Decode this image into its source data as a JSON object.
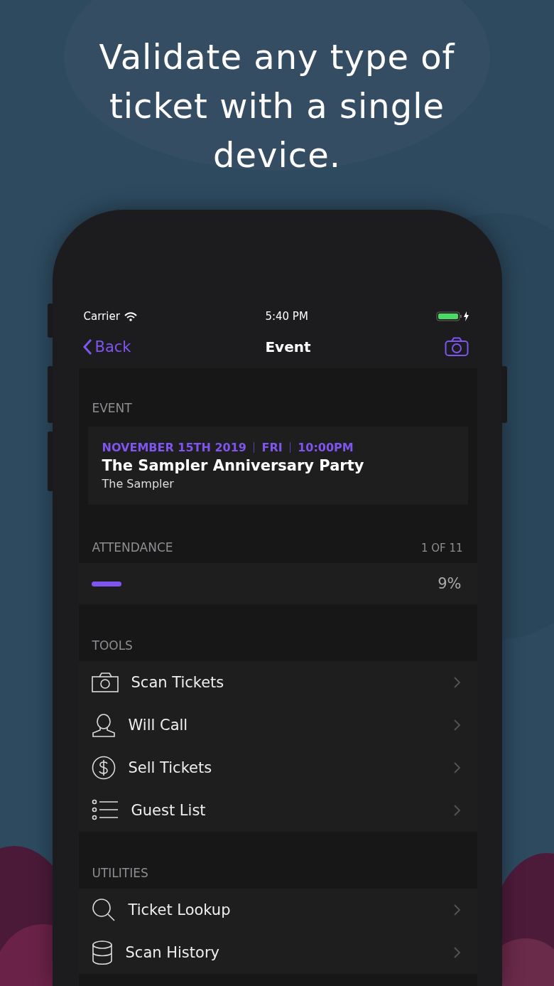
{
  "headline": "Validate any type of ticket with a single device.",
  "status_bar": {
    "carrier": "Carrier",
    "time": "5:40 PM",
    "charging": true
  },
  "nav": {
    "back": "Back",
    "title": "Event"
  },
  "event_section": {
    "header": "EVENT",
    "meta": [
      "NOVEMBER 15TH 2019",
      "FRI",
      "10:00PM"
    ],
    "name": "The Sampler Anniversary Party",
    "venue": "The Sampler"
  },
  "attendance": {
    "header": "ATTENDANCE",
    "count": "1 OF 11",
    "level": 0.09,
    "percent": "9%"
  },
  "sections": [
    {
      "header": "TOOLS",
      "items": [
        {
          "kind": "camera",
          "label": "Scan Tickets"
        },
        {
          "kind": "person",
          "label": "Will Call"
        },
        {
          "kind": "dollar",
          "label": "Sell Tickets"
        },
        {
          "kind": "list",
          "label": "Guest List"
        }
      ]
    },
    {
      "header": "UTILITIES",
      "items": [
        {
          "kind": "search",
          "label": "Ticket Lookup"
        },
        {
          "kind": "database",
          "label": "Scan History"
        }
      ]
    }
  ]
}
